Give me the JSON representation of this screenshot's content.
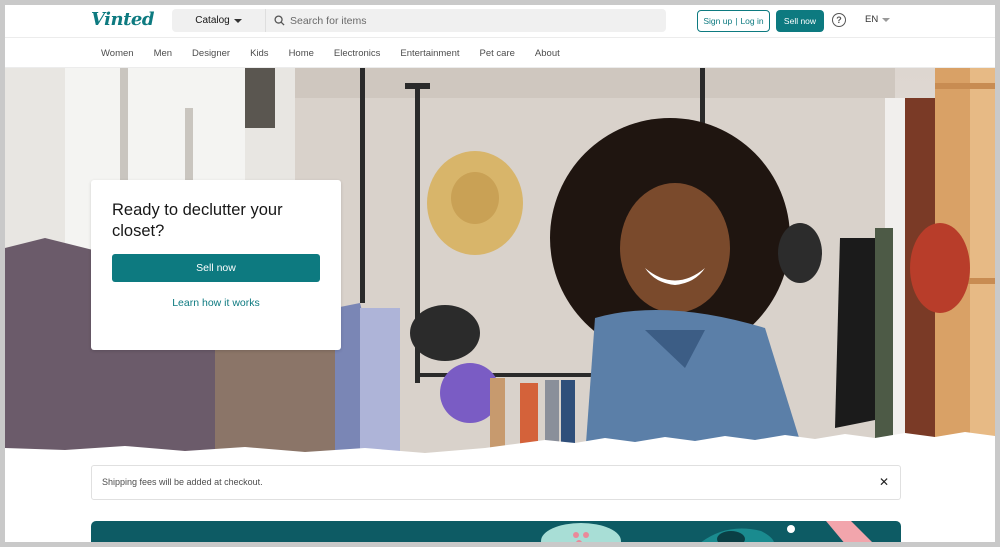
{
  "header": {
    "logo": "Vinted",
    "catalog_label": "Catalog",
    "search_placeholder": "Search for items",
    "signup_label": "Sign up",
    "login_label": "Log in",
    "sell_label": "Sell now",
    "help_label": "?",
    "language": "EN"
  },
  "nav": {
    "items": [
      "Women",
      "Men",
      "Designer",
      "Kids",
      "Home",
      "Electronics",
      "Entertainment",
      "Pet care",
      "About"
    ]
  },
  "hero": {
    "title": "Ready to declutter your closet?",
    "primary_button": "Sell now",
    "secondary_link": "Learn how it works"
  },
  "notice": {
    "text": "Shipping fees will be added at checkout.",
    "close_label": "✕"
  },
  "colors": {
    "brand": "#0d7a80",
    "promo_bg": "#0d5b64"
  }
}
